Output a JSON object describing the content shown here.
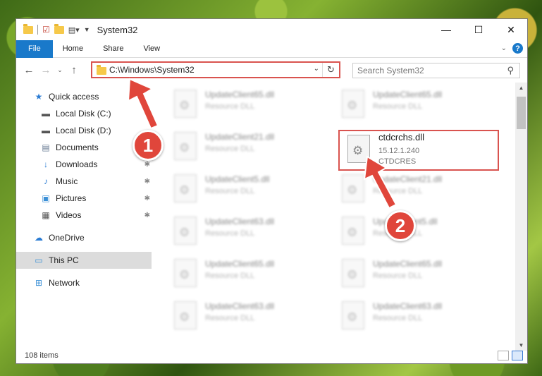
{
  "window": {
    "title": "System32",
    "controls": {
      "minimize": "—",
      "maximize": "☐",
      "close": "✕"
    }
  },
  "ribbon": {
    "tabs": [
      "File",
      "Home",
      "Share",
      "View"
    ]
  },
  "nav": {
    "address": "C:\\Windows\\System32",
    "search_placeholder": "Search System32"
  },
  "sidebar": {
    "quick_access": "Quick access",
    "items": [
      {
        "label": "Local Disk (C:)",
        "icon": "drive-icon",
        "pinned": true
      },
      {
        "label": "Local Disk (D:)",
        "icon": "drive-icon",
        "pinned": false
      },
      {
        "label": "Documents",
        "icon": "documents-icon",
        "pinned": true
      },
      {
        "label": "Downloads",
        "icon": "downloads-icon",
        "pinned": true
      },
      {
        "label": "Music",
        "icon": "music-icon",
        "pinned": true
      },
      {
        "label": "Pictures",
        "icon": "pictures-icon",
        "pinned": true
      },
      {
        "label": "Videos",
        "icon": "videos-icon",
        "pinned": true
      }
    ],
    "onedrive": "OneDrive",
    "this_pc": "This PC",
    "network": "Network"
  },
  "files": [
    {
      "name": "UpdateClient65.dll",
      "sub": "Resource DLL",
      "blur": true
    },
    {
      "name": "UpdateClient65.dll",
      "sub": "Resource DLL",
      "blur": true
    },
    {
      "name": "UpdateClient21.dll",
      "sub": "Resource DLL",
      "blur": true
    },
    {
      "name": "ctdcrchs.dll",
      "version": "15.12.1.240",
      "company": "CTDCRES",
      "blur": false
    },
    {
      "name": "UpdateClient5.dll",
      "sub": "Resource DLL",
      "blur": true
    },
    {
      "name": "UpdateClient21.dll",
      "sub": "Resource DLL",
      "blur": true
    },
    {
      "name": "UpdateClient63.dll",
      "sub": "Resource DLL",
      "blur": true
    },
    {
      "name": "UpdateClient5.dll",
      "sub": "Resource DLL",
      "blur": true
    },
    {
      "name": "UpdateClient65.dll",
      "sub": "Resource DLL",
      "blur": true
    },
    {
      "name": "UpdateClient65.dll",
      "sub": "Resource DLL",
      "blur": true
    },
    {
      "name": "UpdateClient63.dll",
      "sub": "Resource DLL",
      "blur": true
    },
    {
      "name": "UpdateClient63.dll",
      "sub": "Resource DLL",
      "blur": true
    }
  ],
  "status": {
    "item_count": "108 items"
  },
  "callouts": {
    "one": "1",
    "two": "2"
  },
  "colors": {
    "accent": "#1979ca",
    "callout": "#e0463b",
    "highlight": "#d9534f"
  }
}
